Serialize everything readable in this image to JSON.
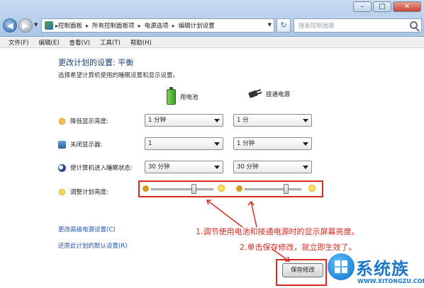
{
  "window": {
    "controls": {
      "minimize": "–",
      "maximize": "□",
      "close": "✕"
    }
  },
  "nav": {
    "back_icon": "back-arrow-icon",
    "forward_icon": "forward-arrow-icon",
    "breadcrumb": [
      "控制面板",
      "所有控制面板项",
      "电源选项",
      "编辑计划设置"
    ],
    "search_placeholder": "搜索控制面板"
  },
  "menu": [
    "文件(F)",
    "编辑(E)",
    "查看(V)",
    "工具(T)",
    "帮助(H)"
  ],
  "main": {
    "title": "更改计划的设置: 平衡",
    "description": "选择希望计算机使用的睡眠设置和显示设置。",
    "columns": {
      "battery": "用电池",
      "plugged_in": "接通电源"
    },
    "rows": [
      {
        "label": "降低显示亮度:",
        "icon": "dim-display-icon",
        "battery": "1 分钟",
        "plugged_in": "1 分"
      },
      {
        "label": "关闭显示器:",
        "icon": "monitor-icon",
        "battery": "1",
        "plugged_in": "1 分钟"
      },
      {
        "label": "使计算机进入睡眠状态:",
        "icon": "sleep-moon-icon",
        "battery": "30 分钟",
        "plugged_in": "30 分钟"
      }
    ],
    "brightness": {
      "label": "调整计划亮度:",
      "battery_level": 0.7,
      "plugged_in_level": 0.75
    },
    "links": {
      "advanced": "更改高级电源设置(C)",
      "restore": "还原此计划的默认设置(R)"
    },
    "save_button": "保存修改"
  },
  "annotations": {
    "note1": "1.调节使用电池和接通电源时的显示屏幕亮度。",
    "note2": "2.单击保存修改，就立即生效了。",
    "color": "#d62b1f"
  },
  "watermark": {
    "title": "系统族",
    "url": "WWW.XITONGZU.COM"
  }
}
